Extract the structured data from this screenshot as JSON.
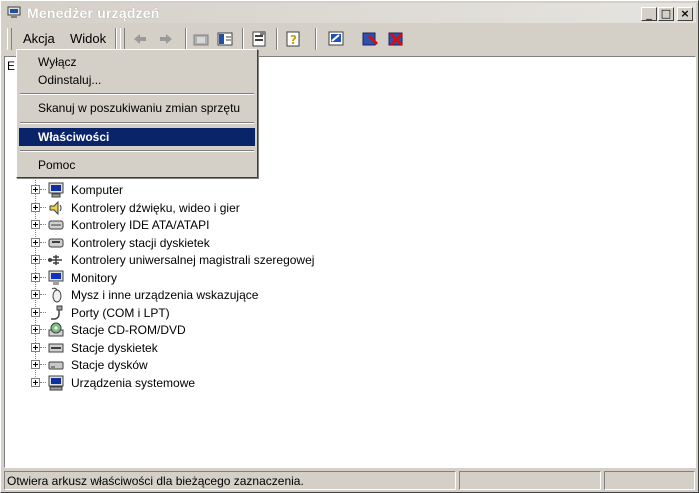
{
  "window": {
    "title": "Menedżer urządzeń",
    "controls": {
      "minimize": "_",
      "maximize": "□",
      "close": "×"
    }
  },
  "menubar": {
    "items": [
      {
        "label": "Akcja"
      },
      {
        "label": "Widok"
      }
    ]
  },
  "toolbar": {
    "icons": [
      "back-arrow-icon",
      "forward-arrow-icon",
      "up-folder-icon",
      "show-hide-tree-icon",
      "properties-icon",
      "help-icon",
      "scan-hardware-icon",
      "update-driver-icon",
      "uninstall-icon"
    ]
  },
  "context_menu": {
    "items": [
      {
        "label": "Wyłącz"
      },
      {
        "label": "Odinstaluj..."
      },
      {
        "label": "Skanuj w poszukiwaniu zmian sprzętu"
      },
      {
        "label": "Właściwości"
      },
      {
        "label": "Pomoc"
      }
    ]
  },
  "tree": {
    "root_partial": "E",
    "items": [
      {
        "label": "Komputer",
        "icon": "computer-icon"
      },
      {
        "label": "Kontrolery dźwięku, wideo i gier",
        "icon": "speaker-icon"
      },
      {
        "label": "Kontrolery IDE ATA/ATAPI",
        "icon": "ide-controller-icon"
      },
      {
        "label": "Kontrolery stacji dyskietek",
        "icon": "floppy-controller-icon"
      },
      {
        "label": "Kontrolery uniwersalnej magistrali szeregowej",
        "icon": "usb-icon"
      },
      {
        "label": "Monitory",
        "icon": "monitor-icon"
      },
      {
        "label": "Mysz i inne urządzenia wskazujące",
        "icon": "mouse-icon"
      },
      {
        "label": "Porty (COM i LPT)",
        "icon": "port-icon"
      },
      {
        "label": "Stacje CD-ROM/DVD",
        "icon": "cdrom-icon"
      },
      {
        "label": "Stacje dyskietek",
        "icon": "floppy-drive-icon"
      },
      {
        "label": "Stacje dysków",
        "icon": "disk-drive-icon"
      },
      {
        "label": "Urządzenia systemowe",
        "icon": "system-device-icon"
      }
    ]
  },
  "statusbar": {
    "text": "Otwiera arkusz właściwości dla bieżącego zaznaczenia."
  },
  "colors": {
    "selection": "#0a246a",
    "face": "#d4d0c8"
  }
}
